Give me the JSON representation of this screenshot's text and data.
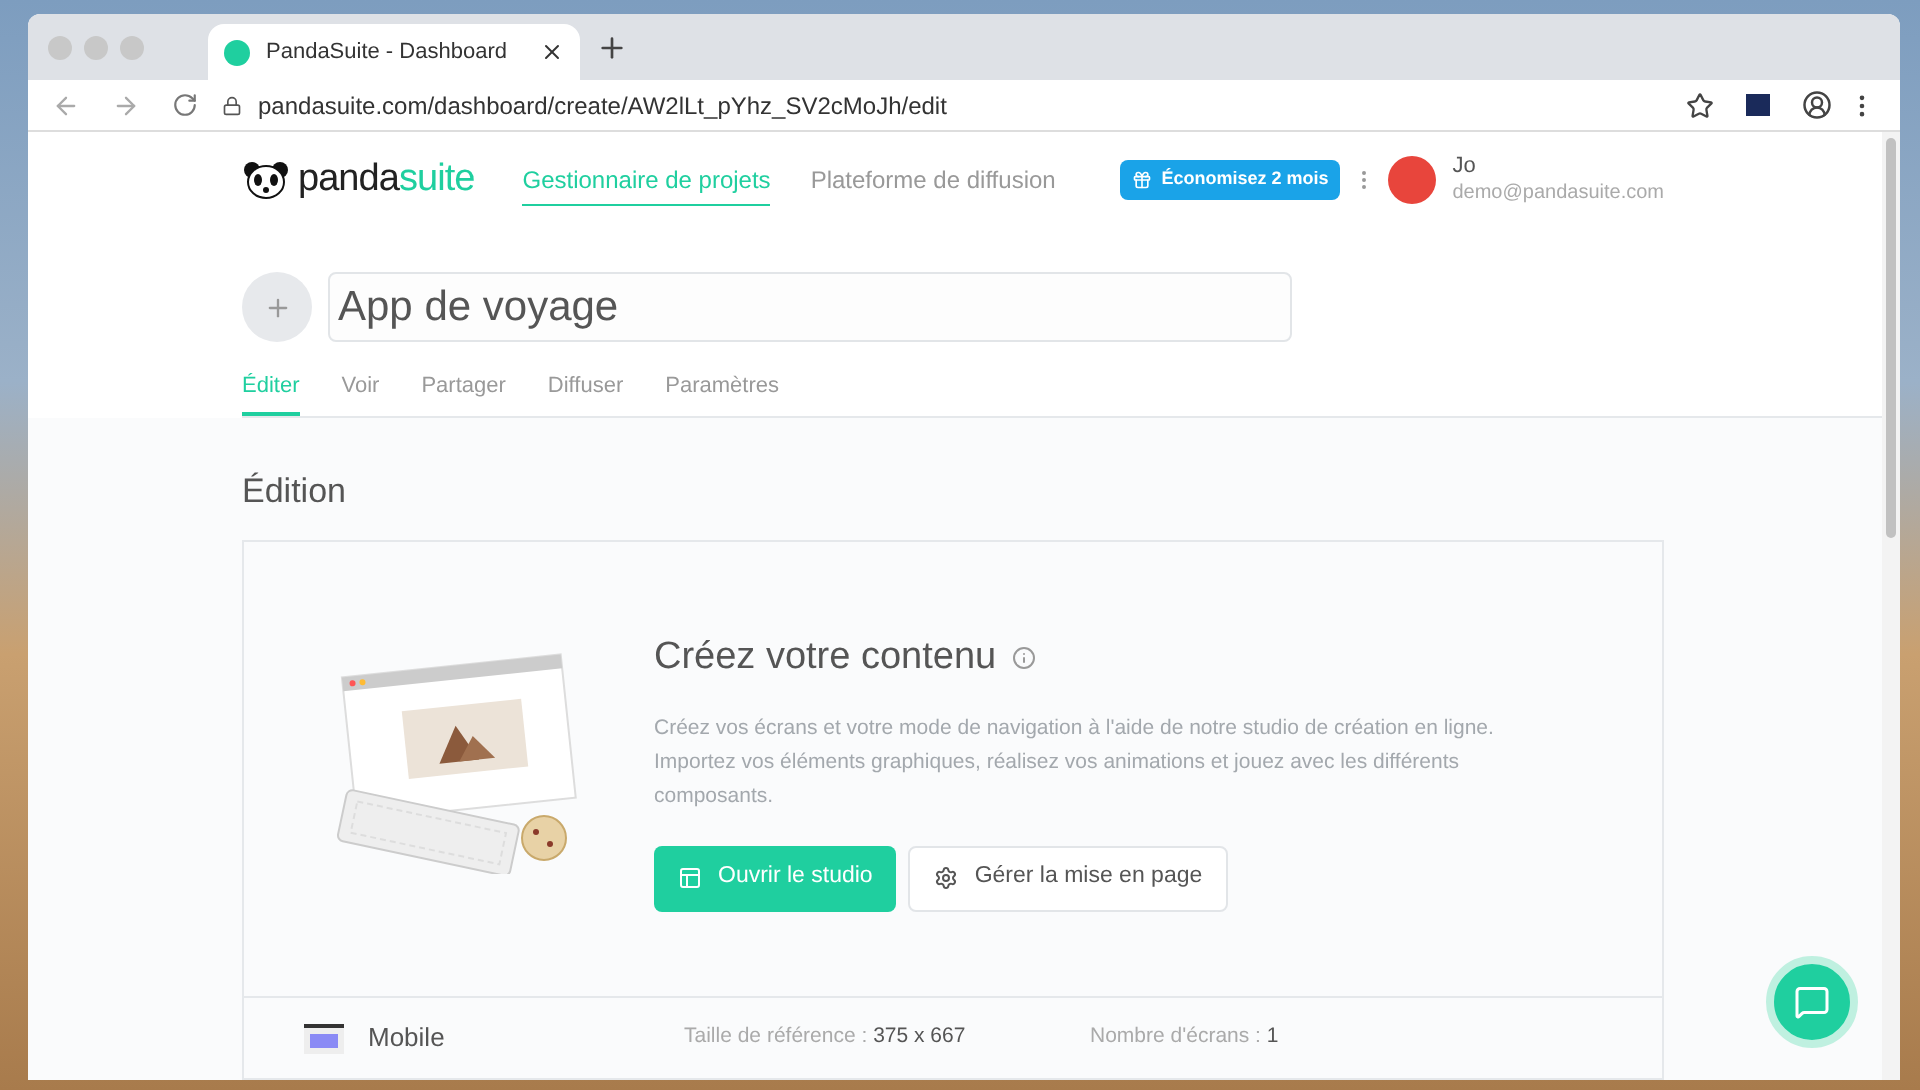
{
  "browser": {
    "tab_title": "PandaSuite - Dashboard",
    "url": "pandasuite.com/dashboard/create/AW2lLt_pYhz_SV2cMoJh/edit"
  },
  "header": {
    "logo": {
      "part1": "panda",
      "part2": "suite"
    },
    "nav": [
      {
        "label": "Gestionnaire de projets",
        "selected": true
      },
      {
        "label": "Plateforme de diffusion",
        "selected": false
      }
    ],
    "promo": "Économisez 2 mois",
    "user": {
      "name": "Jo",
      "email": "demo@pandasuite.com"
    }
  },
  "project": {
    "title": "App de voyage"
  },
  "tabs": [
    {
      "label": "Éditer",
      "selected": true
    },
    {
      "label": "Voir",
      "selected": false
    },
    {
      "label": "Partager",
      "selected": false
    },
    {
      "label": "Diffuser",
      "selected": false
    },
    {
      "label": "Paramètres",
      "selected": false
    }
  ],
  "section_title": "Édition",
  "card": {
    "title": "Créez votre contenu",
    "description": "Créez vos écrans et votre mode de navigation à l'aide de notre studio de création en ligne. Importez vos éléments graphiques, réalisez vos animations et jouez avec les différents composants.",
    "buttons": [
      {
        "label": "Ouvrir le studio",
        "kind": "primary"
      },
      {
        "label": "Gérer la mise en page",
        "kind": "secondary"
      }
    ]
  },
  "format": {
    "name": "Mobile",
    "reference_label": "Taille de référence :",
    "reference_value": "375 x 667",
    "screens_label": "Nombre d'écrans :",
    "screens_value": "1"
  }
}
